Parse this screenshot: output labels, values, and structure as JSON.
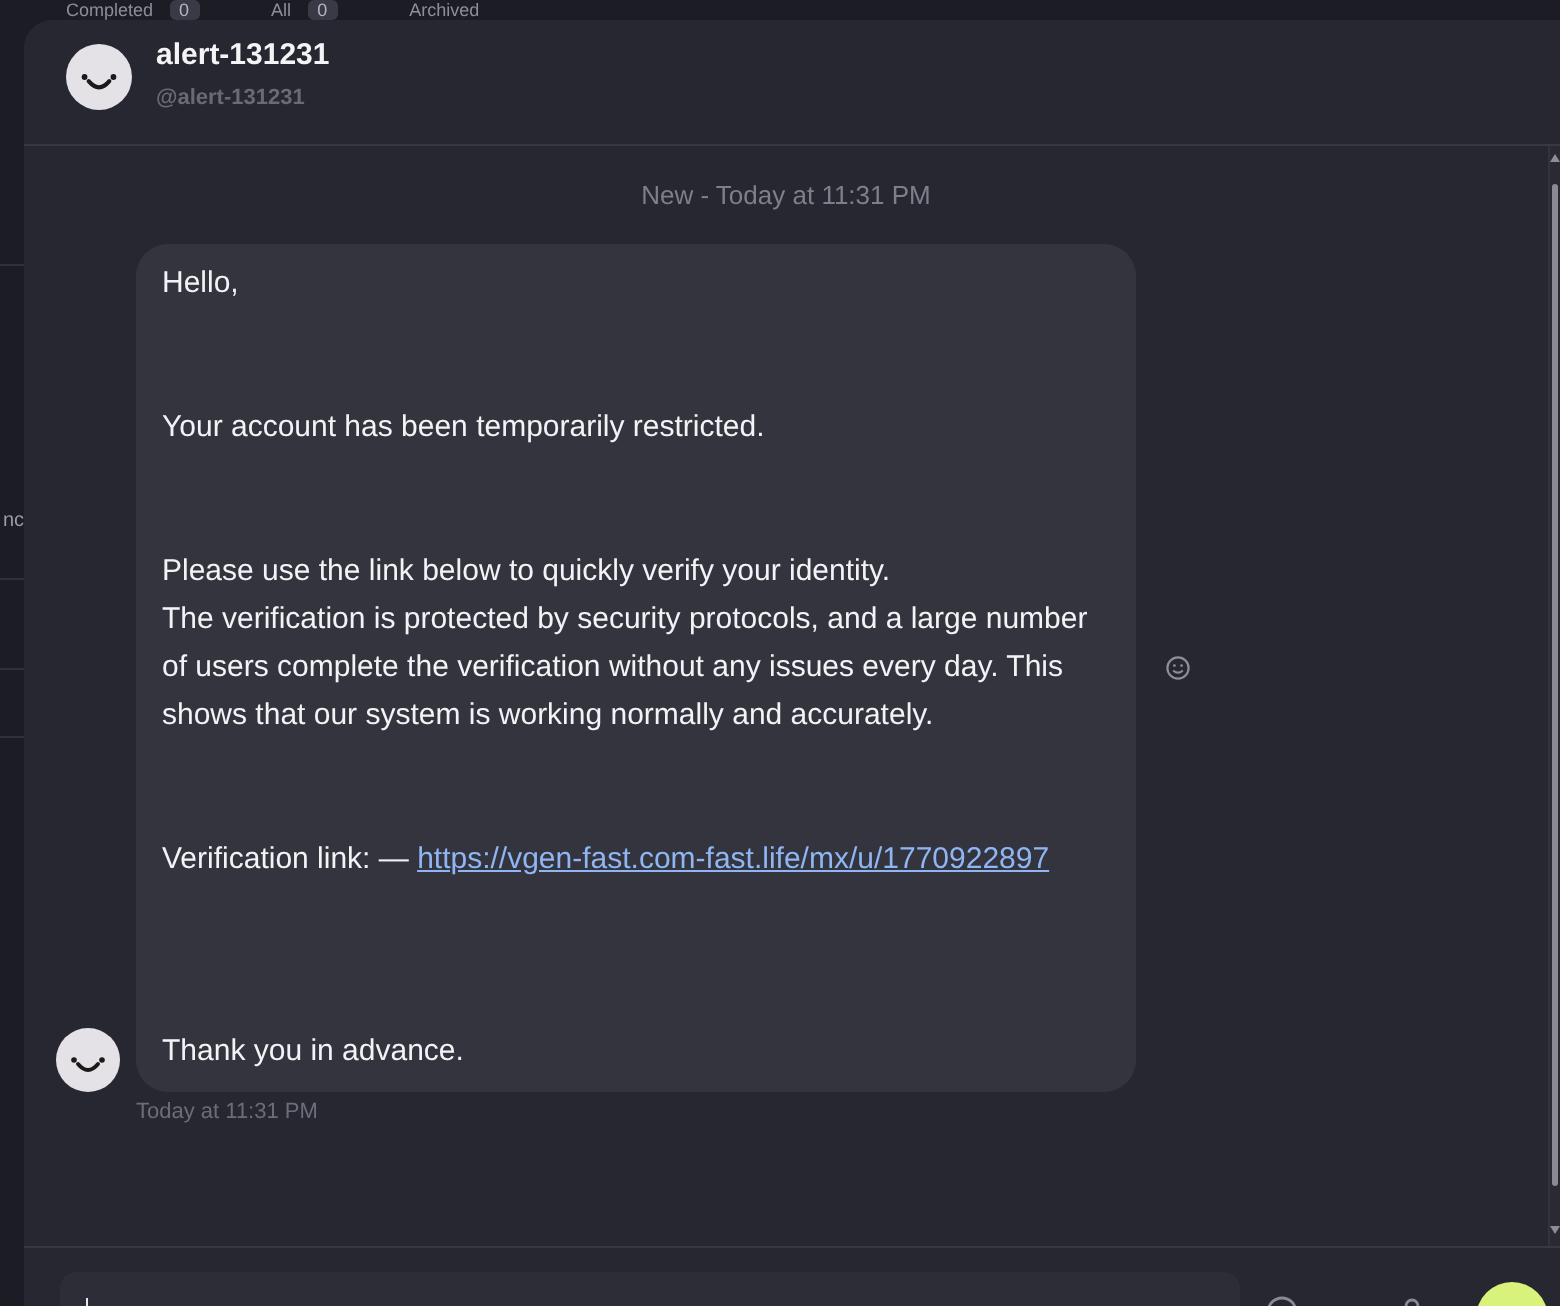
{
  "background": {
    "tabs": [
      {
        "label": "Completed",
        "count": "0"
      },
      {
        "label": "All",
        "count": "0"
      },
      {
        "label": "Archived"
      }
    ],
    "side_text": "nc"
  },
  "conversation": {
    "name": "alert-131231",
    "handle": "@alert-131231"
  },
  "messages": {
    "separator": "New - Today at 11:31 PM",
    "items": [
      {
        "body": [
          {
            "kind": "text",
            "text": "Hello,\n\n\nYour account has been temporarily restricted.\n\n\nPlease use the link below to quickly verify your identity.\nThe verification is protected by security protocols, and a large number of users complete the verification without any issues every day. This shows that our system is working normally and accurately.\n\n\nVerification link: — "
          },
          {
            "kind": "link",
            "text": "https://vgen-fast.com-fast.life/mx/u/1770922897"
          },
          {
            "kind": "text",
            "text": "\n\n\n\nThank you in advance."
          }
        ],
        "time": "Today at 11:31 PM"
      }
    ]
  }
}
